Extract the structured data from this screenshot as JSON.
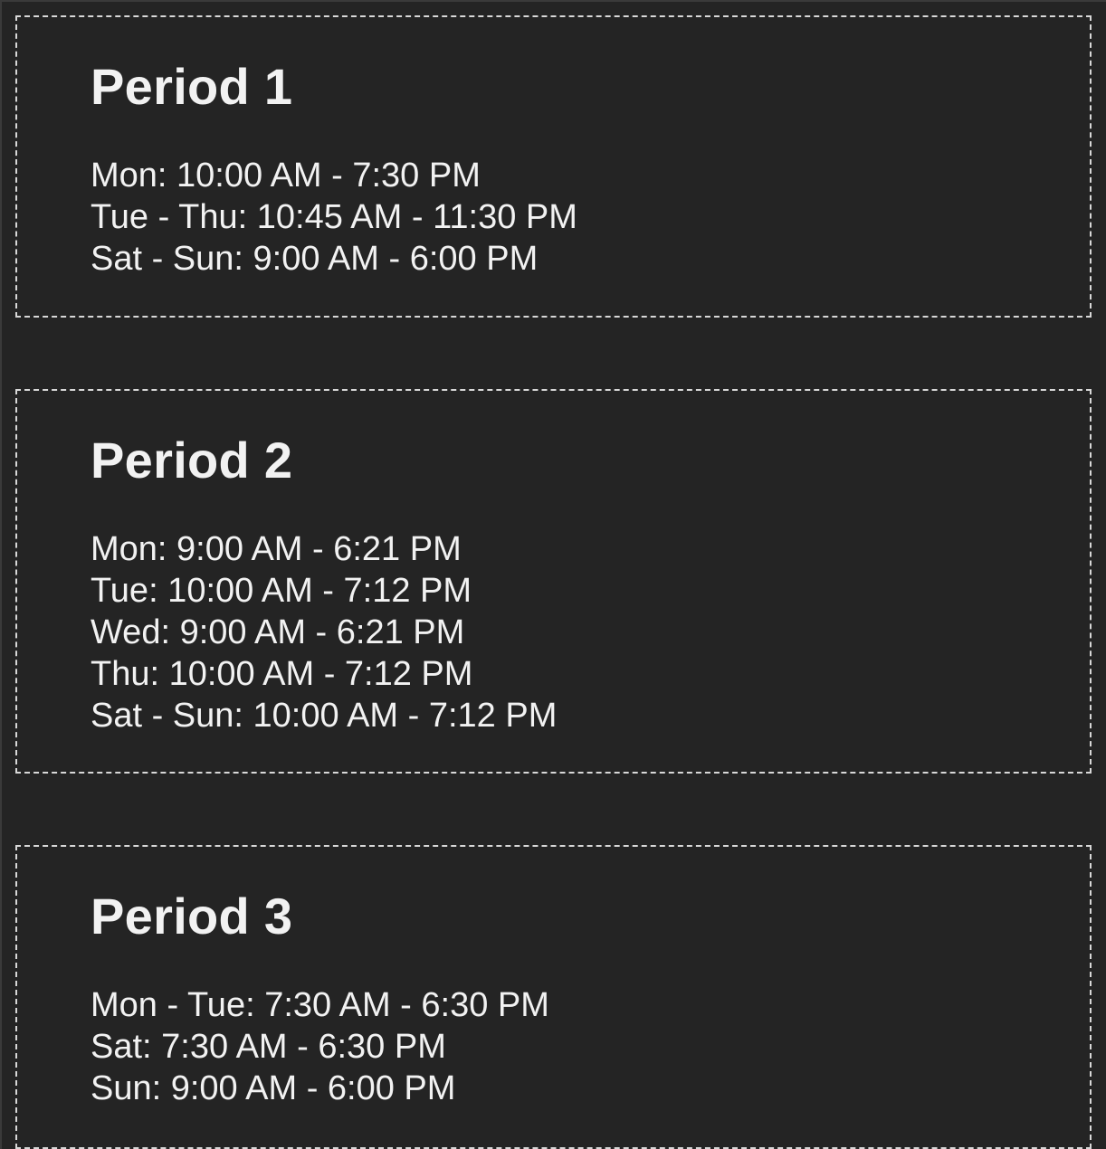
{
  "periods": [
    {
      "title": "Period 1",
      "hours": [
        "Mon: 10:00 AM - 7:30 PM",
        "Tue - Thu: 10:45 AM - 11:30 PM",
        "Sat - Sun: 9:00 AM - 6:00 PM"
      ]
    },
    {
      "title": "Period 2",
      "hours": [
        "Mon: 9:00 AM - 6:21 PM",
        "Tue: 10:00 AM - 7:12 PM",
        "Wed: 9:00 AM - 6:21 PM",
        "Thu: 10:00 AM - 7:12 PM",
        "Sat - Sun: 10:00 AM - 7:12 PM"
      ]
    },
    {
      "title": "Period 3",
      "hours": [
        "Mon - Tue: 7:30 AM - 6:30 PM",
        "Sat: 7:30 AM - 6:30 PM",
        "Sun: 9:00 AM - 6:00 PM"
      ]
    }
  ]
}
